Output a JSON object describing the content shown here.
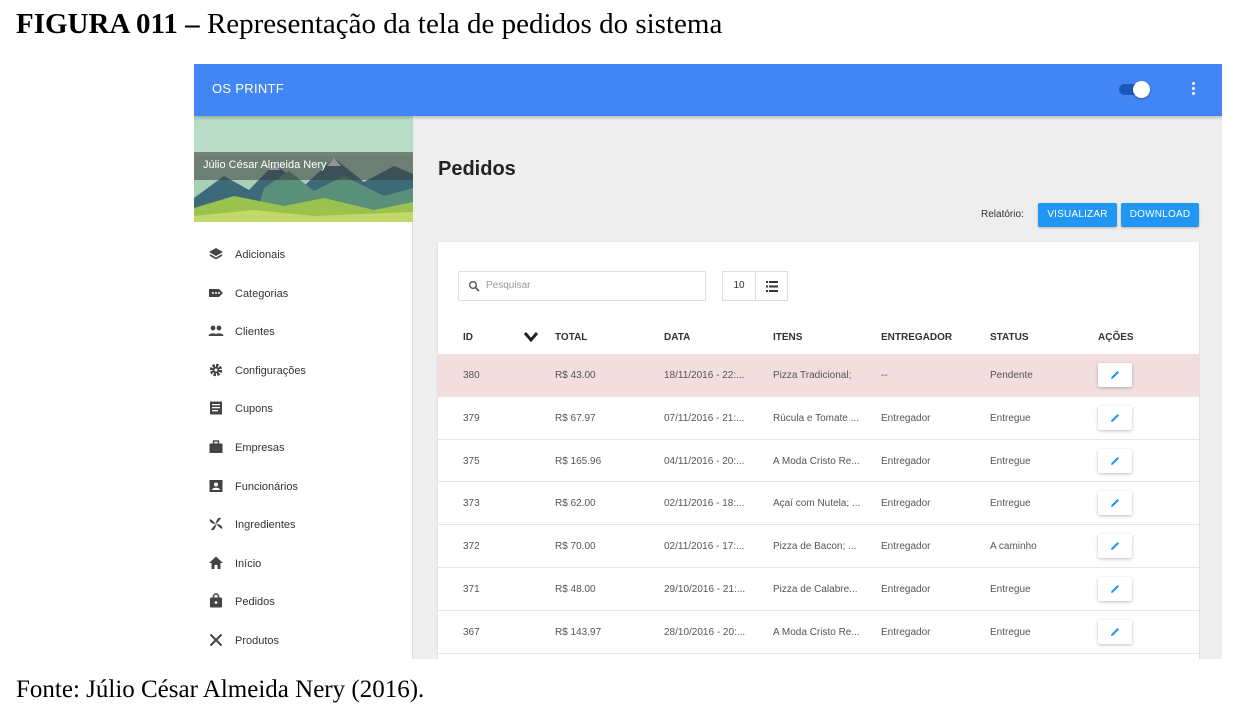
{
  "figure": {
    "caption_bold": "FIGURA 011 –",
    "caption_text": " Representação da tela de pedidos do sistema",
    "source": "Fonte: Júlio César Almeida Nery (2016)."
  },
  "app": {
    "title": "OS PRINTF",
    "toggle_on": true
  },
  "sidebar": {
    "user_name": "Júlio César Almeida Nery",
    "items": [
      {
        "label": "Adicionais",
        "icon": "layers-icon"
      },
      {
        "label": "Categorias",
        "icon": "label-icon"
      },
      {
        "label": "Clientes",
        "icon": "people-icon"
      },
      {
        "label": "Configurações",
        "icon": "gear-icon"
      },
      {
        "label": "Cupons",
        "icon": "list-doc-icon"
      },
      {
        "label": "Empresas",
        "icon": "briefcase-icon"
      },
      {
        "label": "Funcionários",
        "icon": "badge-icon"
      },
      {
        "label": "Ingredientes",
        "icon": "pinwheel-icon"
      },
      {
        "label": "Início",
        "icon": "home-icon"
      },
      {
        "label": "Pedidos",
        "icon": "shopping-bag-icon"
      },
      {
        "label": "Produtos",
        "icon": "utensils-icon"
      }
    ]
  },
  "main": {
    "title": "Pedidos",
    "report_label": "Relatório:",
    "view_button": "VISUALIZAR",
    "download_button": "DOWNLOAD",
    "search_placeholder": "Pesquisar",
    "page_size": "10",
    "columns": {
      "id": "ID",
      "total": "TOTAL",
      "data": "DATA",
      "itens": "ITENS",
      "entregador": "ENTREGADOR",
      "status": "STATUS",
      "acoes": "AÇÕES"
    },
    "rows": [
      {
        "id": "380",
        "total": "R$ 43.00",
        "data": "18/11/2016 - 22:...",
        "itens": "Pizza Tradicional;",
        "entregador": "--",
        "status": "Pendente",
        "highlight": true
      },
      {
        "id": "379",
        "total": "R$ 67.97",
        "data": "07/11/2016 - 21:...",
        "itens": "Rúcula e Tomate ...",
        "entregador": "Entregador",
        "status": "Entregue",
        "highlight": false
      },
      {
        "id": "375",
        "total": "R$ 165.96",
        "data": "04/11/2016 - 20:...",
        "itens": "A Moda Cristo Re...",
        "entregador": "Entregador",
        "status": "Entregue",
        "highlight": false
      },
      {
        "id": "373",
        "total": "R$ 62.00",
        "data": "02/11/2016 - 18:...",
        "itens": "Açaí com Nutela; ...",
        "entregador": "Entregador",
        "status": "Entregue",
        "highlight": false
      },
      {
        "id": "372",
        "total": "R$ 70.00",
        "data": "02/11/2016 - 17:...",
        "itens": "Pizza de Bacon; ...",
        "entregador": "Entregador",
        "status": "A caminho",
        "highlight": false
      },
      {
        "id": "371",
        "total": "R$ 48.00",
        "data": "29/10/2016 - 21:...",
        "itens": "Pizza de Calabre...",
        "entregador": "Entregador",
        "status": "Entregue",
        "highlight": false
      },
      {
        "id": "367",
        "total": "R$ 143.97",
        "data": "28/10/2016 - 20:...",
        "itens": "A Moda Cristo Re...",
        "entregador": "Entregador",
        "status": "Entregue",
        "highlight": false
      }
    ]
  },
  "colors": {
    "appbar": "#4285f4",
    "button": "#2196f3",
    "highlight_row": "#f2dede",
    "background": "#eeeeee"
  }
}
